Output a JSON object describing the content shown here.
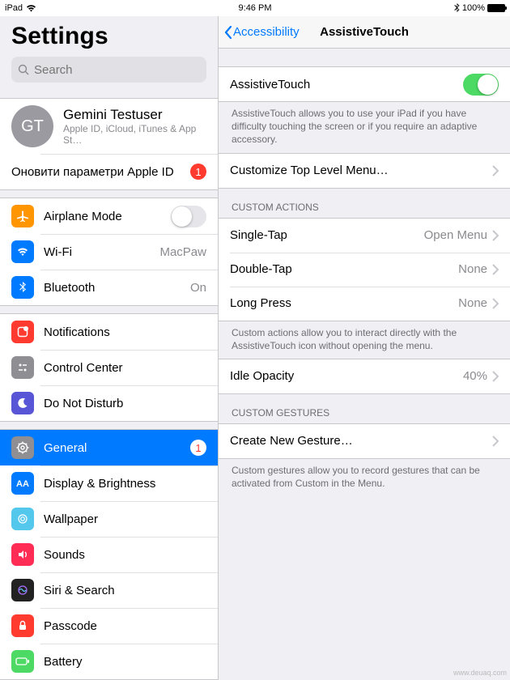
{
  "status": {
    "device": "iPad",
    "time": "9:46 PM",
    "battery_pct": "100%"
  },
  "sidebar": {
    "title": "Settings",
    "search_placeholder": "Search",
    "account": {
      "initials": "GT",
      "name": "Gemini Testuser",
      "sub": "Apple ID, iCloud, iTunes & App St…"
    },
    "apple_id_update": {
      "label": "Оновити параметри Apple ID",
      "badge": "1"
    },
    "airplane": "Airplane Mode",
    "wifi": {
      "label": "Wi-Fi",
      "value": "MacPaw"
    },
    "bluetooth": {
      "label": "Bluetooth",
      "value": "On"
    },
    "notifications": "Notifications",
    "control_center": "Control Center",
    "dnd": "Do Not Disturb",
    "general": {
      "label": "General",
      "badge": "1"
    },
    "display": "Display & Brightness",
    "wallpaper": "Wallpaper",
    "sounds": "Sounds",
    "siri": "Siri & Search",
    "passcode": "Passcode",
    "battery": "Battery"
  },
  "detail": {
    "back": "Accessibility",
    "title": "AssistiveTouch",
    "main_toggle": "AssistiveTouch",
    "main_desc": "AssistiveTouch allows you to use your iPad if you have difficulty touching the screen or if you require an adaptive accessory.",
    "customize": "Customize Top Level Menu…",
    "custom_actions_header": "CUSTOM ACTIONS",
    "single_tap": {
      "label": "Single-Tap",
      "value": "Open Menu"
    },
    "double_tap": {
      "label": "Double-Tap",
      "value": "None"
    },
    "long_press": {
      "label": "Long Press",
      "value": "None"
    },
    "custom_actions_footer": "Custom actions allow you to interact directly with the AssistiveTouch icon without opening the menu.",
    "idle_opacity": {
      "label": "Idle Opacity",
      "value": "40%"
    },
    "custom_gestures_header": "CUSTOM GESTURES",
    "create_gesture": "Create New Gesture…",
    "custom_gestures_footer": "Custom gestures allow you to record gestures that can be activated from Custom in the Menu."
  },
  "watermark": "www.deuaq.com"
}
